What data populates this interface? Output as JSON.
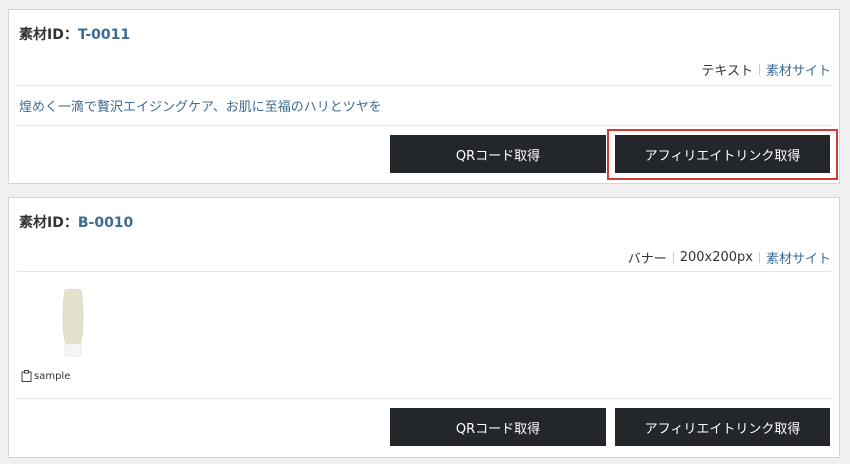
{
  "items": [
    {
      "id_label": "素材ID：",
      "id_value": "T-0011",
      "meta_type": "テキスト",
      "meta_link": "素材サイト",
      "description": "煌めく一滴で贅沢エイジングケア、お肌に至福のハリとツヤを",
      "qr_button": "QRコード取得",
      "affiliate_button": "アフィリエイトリンク取得"
    },
    {
      "id_label": "素材ID：",
      "id_value": "B-0010",
      "meta_type": "バナー",
      "meta_size": "200x200px",
      "meta_link": "素材サイト",
      "caption": "sample",
      "qr_button": "QRコード取得",
      "affiliate_button": "アフィリエイトリンク取得"
    }
  ],
  "colors": {
    "link": "#3d6b93",
    "button_bg": "#23262b",
    "highlight": "#d23a3a"
  }
}
